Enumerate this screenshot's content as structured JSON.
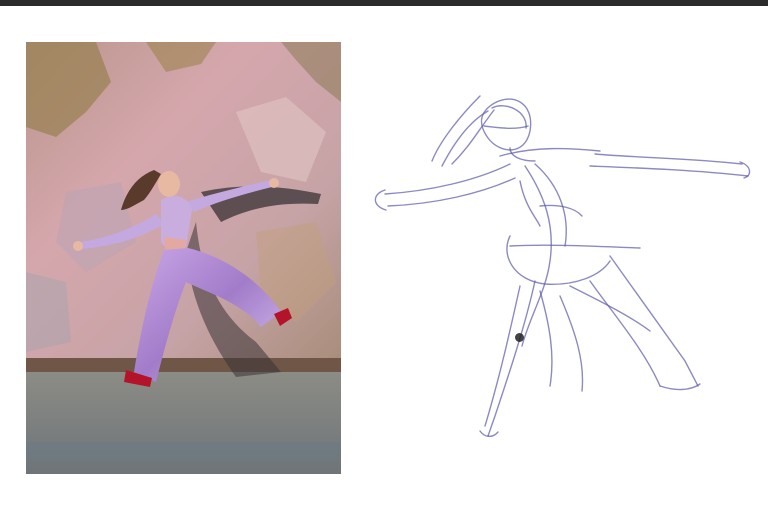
{
  "app": {
    "top_bar_color": "#2b2b2b",
    "canvas_color": "#ffffff"
  },
  "reference_photo": {
    "subject": "dancer",
    "wall_colors": [
      "#c79aa0",
      "#b08a7a",
      "#d7b9b4",
      "#8f7b58"
    ],
    "outfit_color": "#b48fd6",
    "shoe_color": "#b3142a",
    "floor_color": "#7c7f80"
  },
  "gesture_sketch": {
    "stroke_color": "#5a58a8",
    "stroke_opacity": 0.7
  },
  "cursor": {
    "icon": "brush-cursor-icon",
    "color": "#222222"
  }
}
